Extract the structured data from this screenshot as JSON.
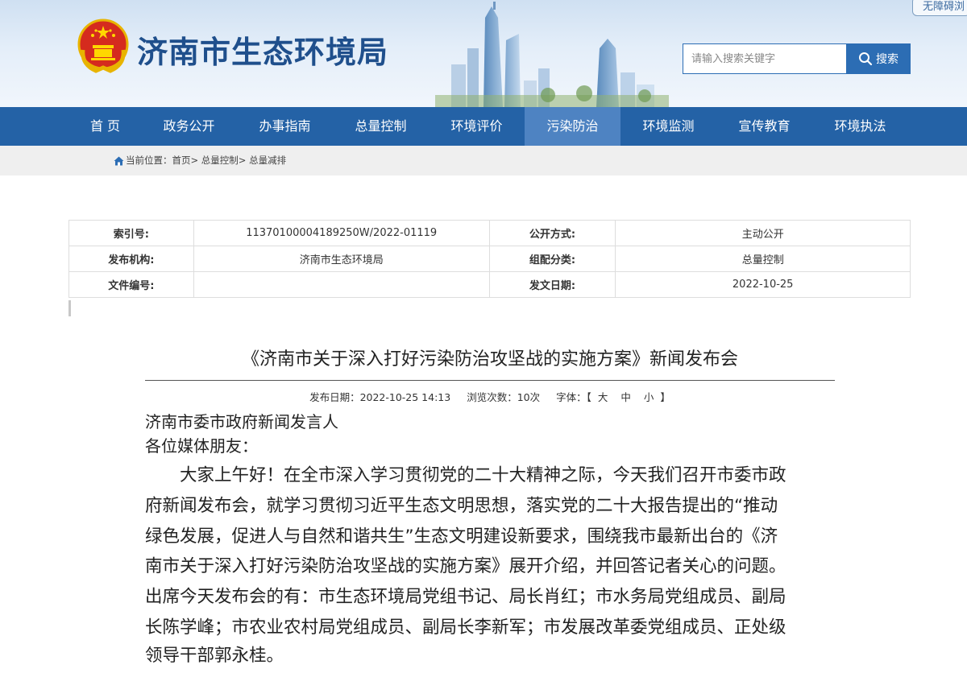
{
  "header": {
    "site_title": "济南市生态环境局",
    "accessibility_label": "无障碍浏",
    "search": {
      "placeholder": "请输入搜索关键字",
      "button_label": "搜索"
    },
    "brand_color": "#2462a6"
  },
  "nav": {
    "items": [
      "首 页",
      "政务公开",
      "办事指南",
      "总量控制",
      "环境评价",
      "污染防治",
      "环境监测",
      "宣传教育",
      "环境执法"
    ],
    "active_index": 5
  },
  "breadcrumb": {
    "prefix": "当前位置：",
    "items": [
      "首页>",
      "总量控制>",
      "总量减排"
    ]
  },
  "meta_table": {
    "rows": [
      [
        "索引号:",
        "11370100004189250W/2022-01119",
        "公开方式:",
        "主动公开"
      ],
      [
        "发布机构:",
        "济南市生态环境局",
        "组配分类:",
        "总量控制"
      ],
      [
        "文件编号:",
        "",
        "发文日期:",
        "2022-10-25"
      ]
    ]
  },
  "article": {
    "title": "《济南市关于深入打好污染防治攻坚战的实施方案》新闻发布会",
    "publish_date": "发布日期：2022-10-25 14:13",
    "views": "浏览次数：10次",
    "font_label": "字体：",
    "font_size_open": "【",
    "font_sizes": [
      "大",
      "中",
      "小"
    ],
    "font_size_close": "】",
    "speaker": "济南市委市政府新闻发言人",
    "greeting": "各位媒体朋友：",
    "body_lines": [
      "　　大家上午好！在全市深入学习贯彻党的二十大精神之际，今天我们召开市委市政",
      "府新闻发布会，就学习贯彻习近平生态文明思想，落实党的二十大报告提出的“推动",
      "绿色发展，促进人与自然和谐共生”生态文明建设新要求，围绕我市最新出台的《济",
      "南市关于深入打好污染防治攻坚战的实施方案》展开介绍，并回答记者关心的问题。",
      "出席今天发布会的有：市生态环境局党组书记、局长肖红；市水务局党组成员、副局",
      "长陈学峰；市农业农村局党组成员、副局长李新军；市发展改革委党组成员、正处级",
      "领导干部郭永桂。"
    ]
  }
}
